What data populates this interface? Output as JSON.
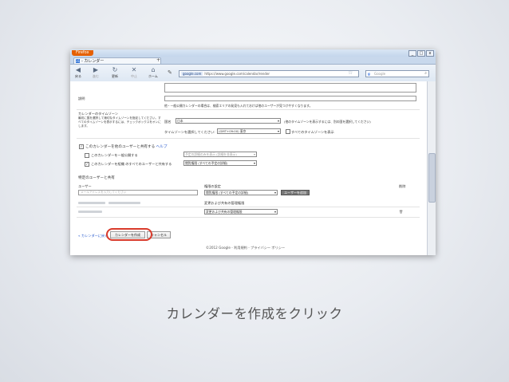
{
  "browser": {
    "app_button": "Firefox",
    "tab_title": "- カレンダー",
    "new_tab": "+",
    "window_buttons": [
      "_",
      "□",
      "x"
    ],
    "nav": [
      {
        "icon": "back-arrow-icon",
        "glyph": "◀",
        "label": "戻る"
      },
      {
        "icon": "forward-arrow-icon",
        "glyph": "▶",
        "label": "進む"
      },
      {
        "icon": "reload-icon",
        "glyph": "↻",
        "label": "更新"
      },
      {
        "icon": "stop-icon",
        "glyph": "✕",
        "label": "中止"
      },
      {
        "icon": "home-icon",
        "glyph": "⌂",
        "label": "ホーム"
      }
    ],
    "url_site": "google.com",
    "url": "https://www.google.com/calendar/render",
    "search_placeholder": "Google",
    "search_g": "g"
  },
  "form": {
    "description_note": "他・一般公開カレンダーの場合は、検索エリアの発見も入れておけば他のユーザーが見つけやすくなります。",
    "desc_label": "説明",
    "timezone_heading": "カレンダーのタイムゾーン",
    "timezone_help": "最初に国を選択して適切なタイムゾーンを指定してください。すべてのタイムゾーンを表示するには、チェックボックスをオンにします。",
    "country_label": "国名",
    "country_value": "日本",
    "country_note": "(他のタイムゾーンを表示するには、別の国を選択してください)",
    "tz_label": "タイムゾーンを選択してください:",
    "tz_value": "(GMT+09:00) 東京",
    "show_all_tz": "すべてのタイムゾーンを表示",
    "share_heading": "このカレンダーを他のユーザーと共有する",
    "share_help": "ヘルプ",
    "public_option": "このカレンダーを一般公開する",
    "public_select": "予定の詳細のみを表示 (詳細を非表示)",
    "domain_option": "このカレンダーを組織 のすべてのユーザーと共有する",
    "domain_select": "閲覧権限 (すべての予定の詳細)",
    "specific_heading": "特定のユーザーと共有",
    "col_user": "ユーザー",
    "col_permission": "権限の設定",
    "col_delete": "削除",
    "email_placeholder": "メールアドレスを入力してください",
    "perm_view_all": "閲覧権限 (すべての予定の詳細)",
    "add_person_button": "ユーザーを追加",
    "perm_edit_manage": "変更および共有の管理権限",
    "perm_edit_manage_select": "変更および共有の管理権限",
    "trash_icon": "🗑",
    "back_link": "« カレンダーに戻る",
    "create_button": "カレンダーを作成",
    "cancel_button": "キャンセル",
    "footer": "©2012 Google - 利用規約 - プライバシー ポリシー"
  },
  "caption": "カレンダーを作成をクリック",
  "colors": {
    "highlight": "#d93a2b",
    "link": "#2255cc",
    "firefox_orange": "#e66000"
  }
}
